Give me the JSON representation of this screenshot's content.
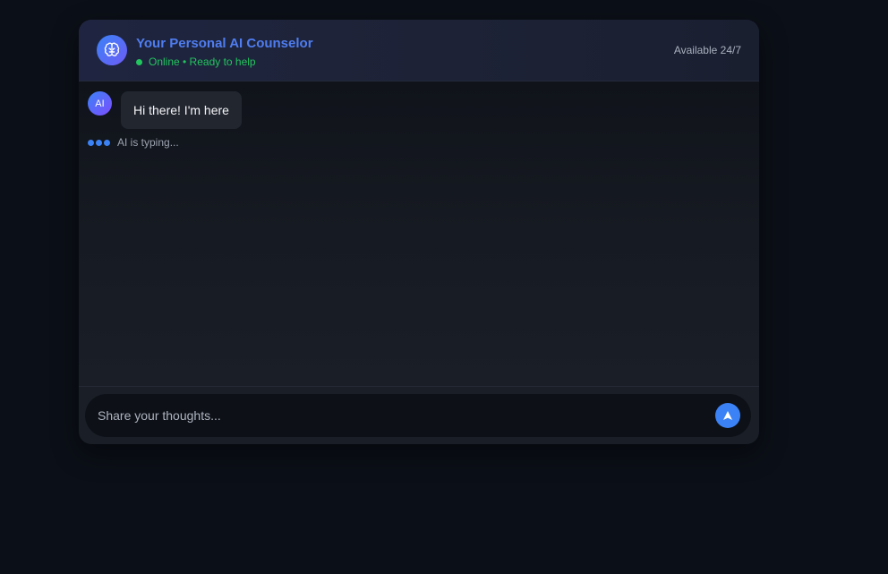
{
  "header": {
    "title": "Your Personal AI Counselor",
    "status": "Online • Ready to help",
    "availability": "Available 24/7",
    "avatar_icon": "brain-icon"
  },
  "messages": [
    {
      "sender_avatar": "AI",
      "text": "Hi there! I'm here"
    }
  ],
  "typing": {
    "text": "AI is typing..."
  },
  "composer": {
    "placeholder": "Share your thoughts...",
    "value": "",
    "send_icon": "send-icon"
  },
  "colors": {
    "accent": "#3b82f6",
    "title": "#4f7df0",
    "online": "#22c55e",
    "background": "#0b0f17"
  }
}
